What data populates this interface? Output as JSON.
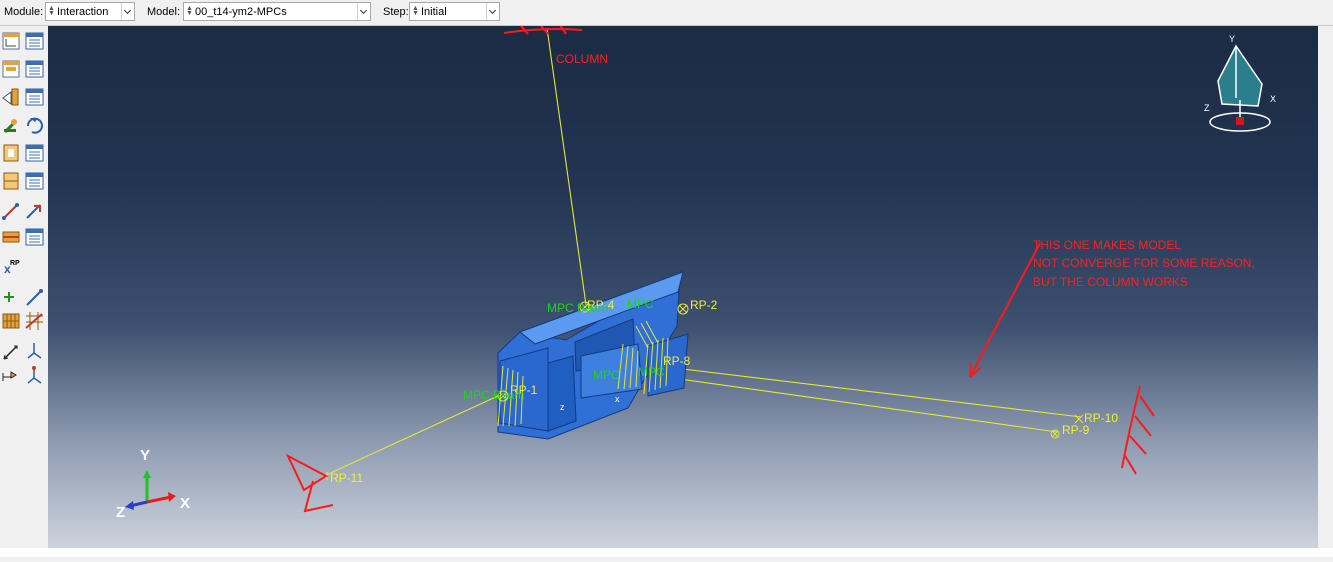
{
  "context_bar": {
    "module_label": "Module:",
    "module_value": "Interaction",
    "model_label": "Model:",
    "model_value": "00_t14-ym2-MPCs",
    "step_label": "Step:",
    "step_value": "Initial"
  },
  "viewport": {
    "colors": {
      "background_top": "#1c2b44",
      "background_bottom": "#cdd3dd",
      "part": "#2f6fd6",
      "wire": "#f2ee34",
      "annotation": "#ff2020",
      "mpc_label": "#22d11f"
    },
    "ref_points": [
      "RP-1",
      "RP-2",
      "RP-8",
      "RP-9",
      "RP-10",
      "RP-11",
      "RP-4"
    ],
    "constraint_labels": [
      "MPC Beam",
      "MPC",
      "MPC",
      "MPC Beam",
      "MPC"
    ],
    "annotations": {
      "column": "COLUMN",
      "note_line1": "THIS ONE MAKES MODEL",
      "note_line2": "NOT CONVERGE FOR SOME REASON,",
      "note_line3": "BUT THE COLUMN WORKS"
    },
    "triad": {
      "x": "X",
      "y": "Y",
      "z": "Z"
    },
    "view_cube": {
      "x": "X",
      "y": "Y",
      "z": "Z"
    },
    "local_csys": {
      "z": "z",
      "x": "x"
    }
  },
  "toolbox": {
    "icons": [
      "create-interaction-icon",
      "interaction-manager-icon",
      "create-interaction-property-icon",
      "interaction-property-manager-icon",
      "create-contact-control-icon",
      "contact-control-manager-icon",
      "create-contact-init-icon",
      "contact-init-manager-icon",
      "create-stabilization-icon",
      "refresh-icon",
      "create-constraint-icon",
      "constraint-manager-icon",
      "create-connector-section-icon",
      "connector-section-manager-icon",
      "create-wire-icon",
      "connector-assignment-icon",
      "create-fastener-icon",
      "fastener-manager-icon",
      "reference-point-icon",
      "create-datum-point-icon",
      "create-datum-line-icon",
      "attachment-points-icon",
      "attachment-lines-icon",
      "query-icon",
      "create-datum-csys-icon",
      "create-special-icon",
      "create-csys-icon"
    ],
    "rp_label": "RP"
  }
}
